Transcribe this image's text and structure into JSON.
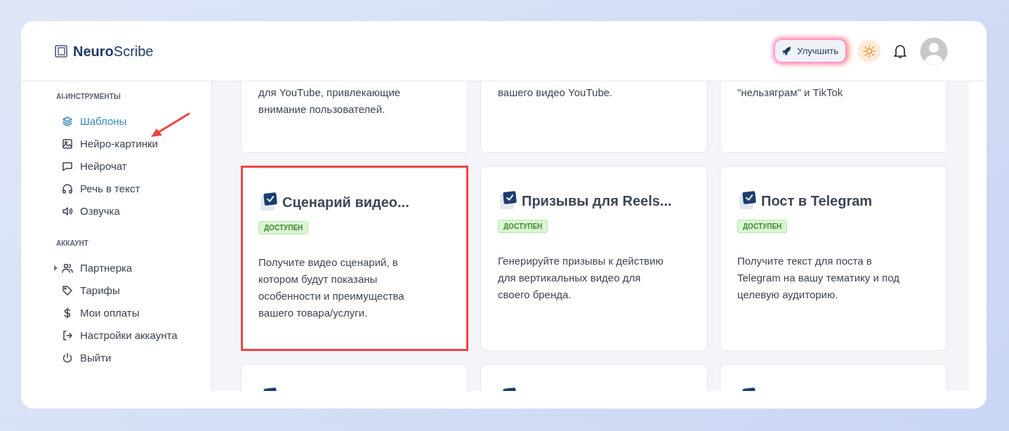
{
  "brand": {
    "name": "**Neuro**Scribe"
  },
  "header": {
    "upgrade_button": "Улучшить"
  },
  "sidebar": {
    "sections": [
      {
        "title": "AI-ИНСТРУМЕНТЫ",
        "items": [
          {
            "label": "Шаблоны",
            "selected": true
          },
          {
            "label": "Нейро-картинки",
            "selected": false
          },
          {
            "label": "Нейрочат",
            "selected": false
          },
          {
            "label": "Речь в текст",
            "selected": false
          },
          {
            "label": "Озвучка",
            "selected": false
          }
        ]
      },
      {
        "title": "АККАУНТ",
        "items": [
          {
            "label": "Партнерка",
            "selected": false,
            "expanded": false
          },
          {
            "label": "Тарифы",
            "selected": false
          },
          {
            "label": "Мои оплаты",
            "selected": false
          },
          {
            "label": "Настройки аккаунта",
            "selected": false
          },
          {
            "label": "Выйти",
            "selected": false
          }
        ]
      }
    ]
  },
  "cards": [
    {
      "kind": "cut_top",
      "description": "для YouTube, привлекающие внимание пользователей.",
      "highlighted": false
    },
    {
      "kind": "cut_top",
      "description": "вашего видео YouTube.",
      "highlighted": false
    },
    {
      "kind": "cut_top",
      "description": "\"нельзяграм\" и TikTok",
      "highlighted": false
    },
    {
      "kind": "full",
      "title": "Сценарий видео...",
      "badge": "ДОСТУПЕН",
      "description": "Получите видео сценарий, в котором будут показаны особенности и преимущества вашего товара/услуги.",
      "highlighted": true
    },
    {
      "kind": "full",
      "title": "Призывы для Reels...",
      "badge": "ДОСТУПЕН",
      "description": "Генерируйте призывы к действию для вертикальных видео для своего бренда.",
      "highlighted": false
    },
    {
      "kind": "full",
      "title": "Пост в Telegram",
      "badge": "ДОСТУПЕН",
      "description": "Получите текст для поста в Telegram на вашу тематику и под целевую аудиторию.",
      "highlighted": false
    },
    {
      "kind": "cut_bottom",
      "highlighted": false
    },
    {
      "kind": "cut_bottom",
      "highlighted": false
    },
    {
      "kind": "cut_bottom",
      "highlighted": false
    }
  ]
}
